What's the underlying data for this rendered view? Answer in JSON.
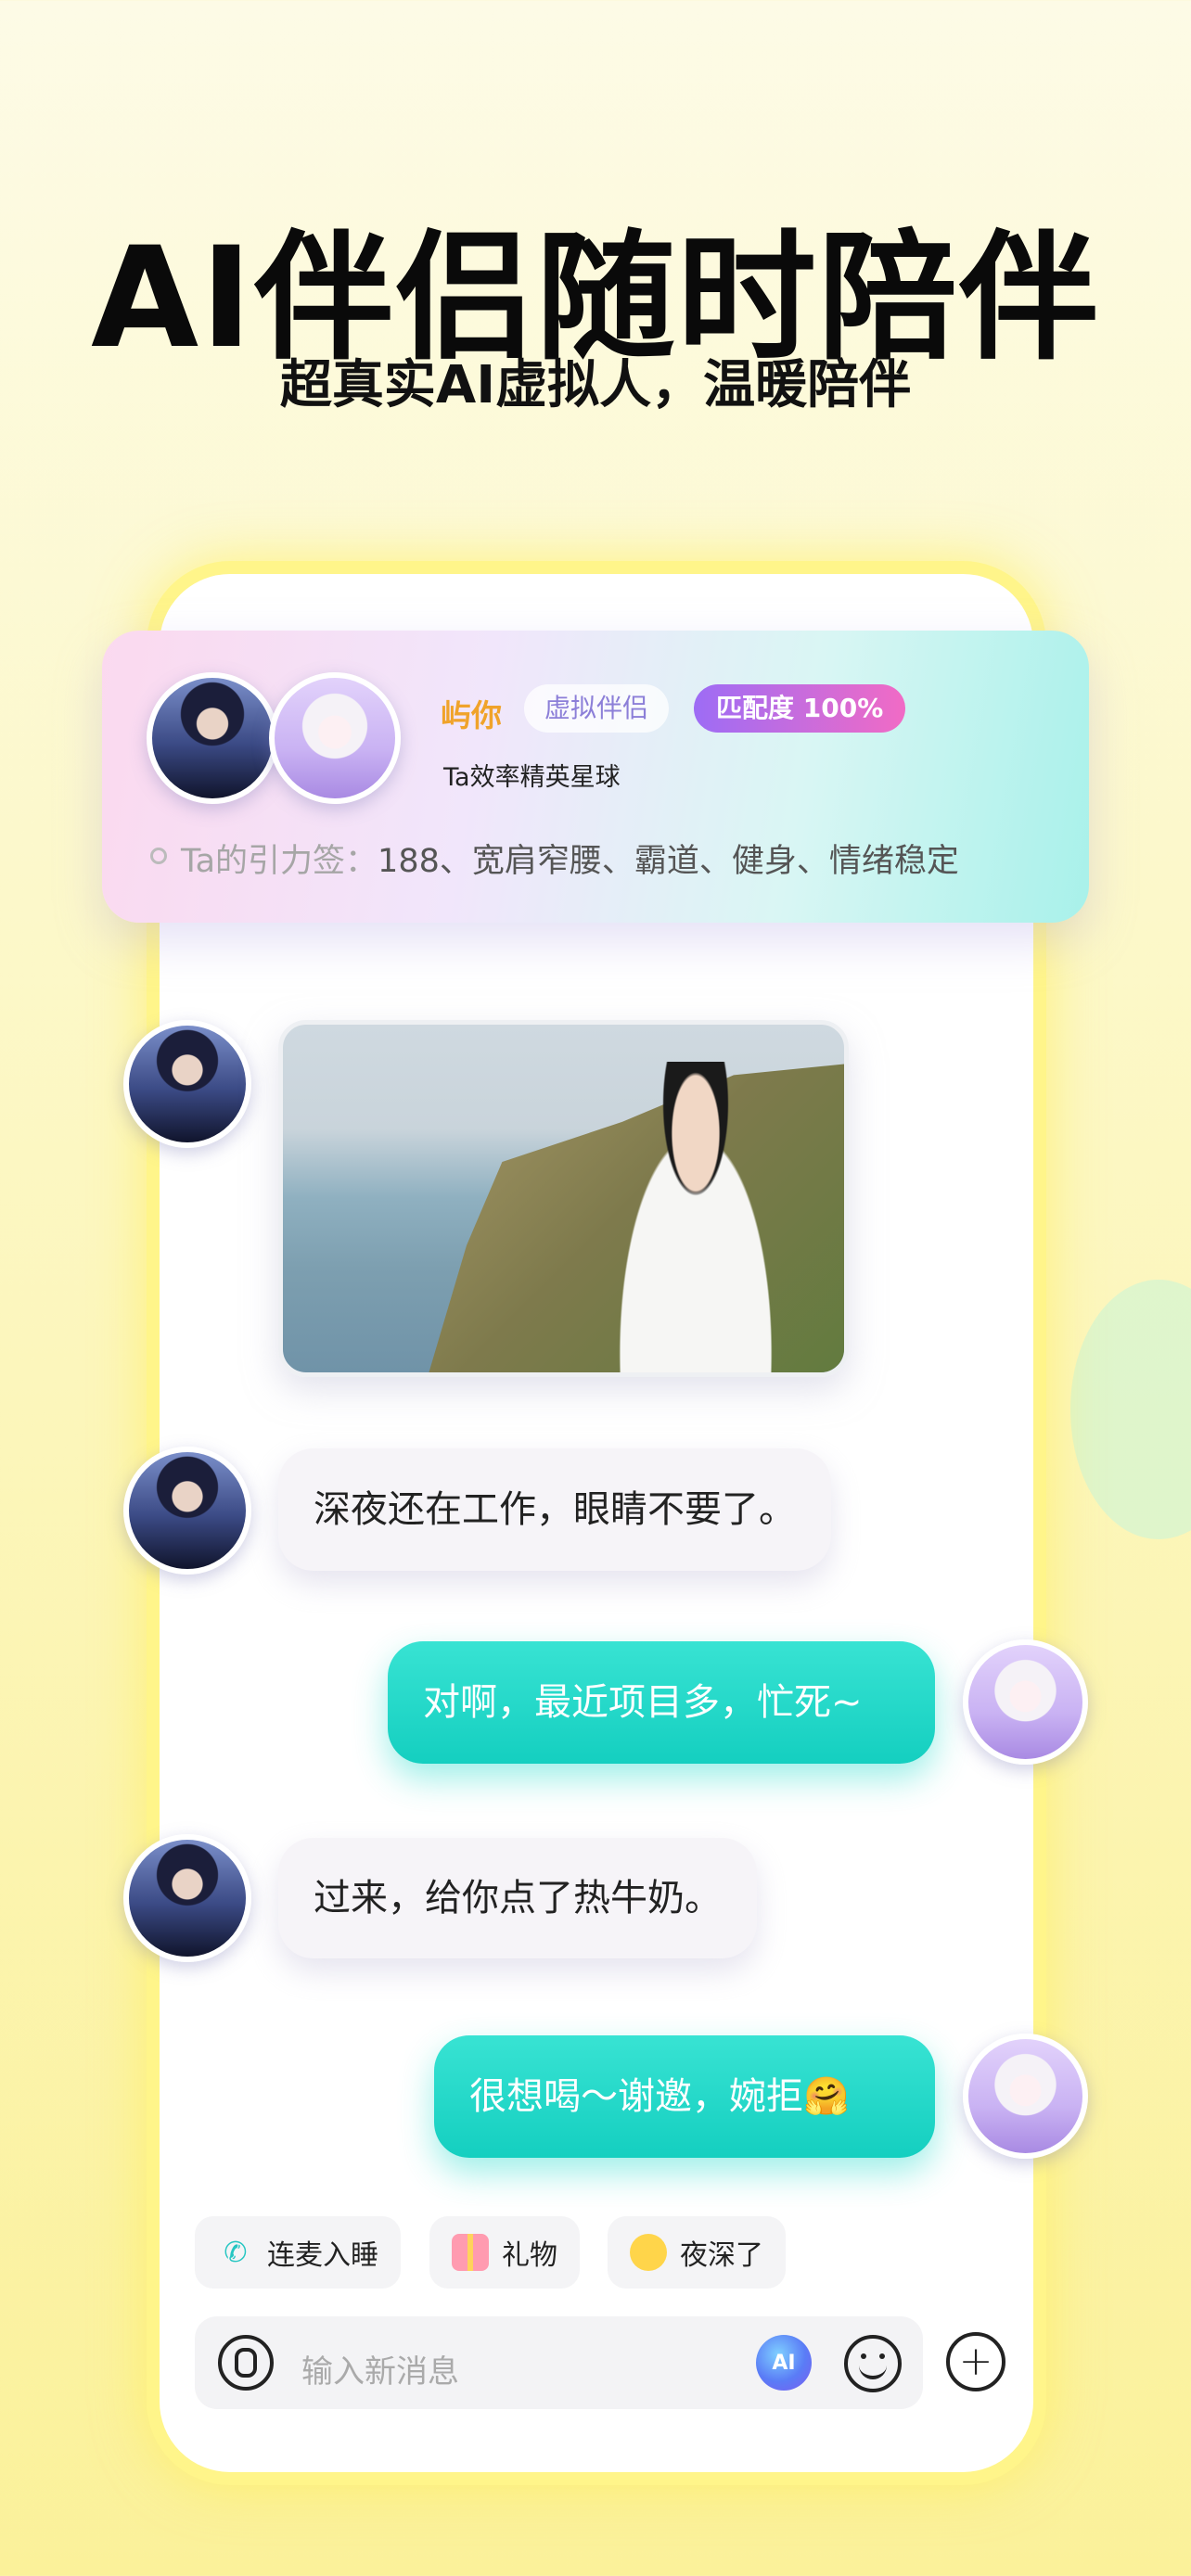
{
  "headline": "AI伴侣随时陪伴",
  "subheadline": "超真实AI虚拟人，温暖陪伴",
  "profile": {
    "name": "屿你",
    "tag": "虚拟伴侣",
    "match": "匹配度 100%",
    "description": "Ta效率精英星球",
    "signature_label": "Ta的引力签：",
    "signature": "188、宽肩窄腰、霸道、健身、情绪稳定"
  },
  "chat": {
    "messages": [
      {
        "from": "ai",
        "type": "image"
      },
      {
        "from": "ai",
        "text": "深夜还在工作，眼睛不要了。"
      },
      {
        "from": "user",
        "text": "对啊，最近项目多，忙死~"
      },
      {
        "from": "ai",
        "text": "过来，给你点了热牛奶。"
      },
      {
        "from": "user",
        "text": "很想喝～谢邀，婉拒🤗"
      }
    ]
  },
  "quick_actions": [
    {
      "label": "连麦入睡",
      "icon": "phone-sleep-icon"
    },
    {
      "label": "礼物",
      "icon": "gift-icon"
    },
    {
      "label": "夜深了",
      "icon": "sleepy-emoji-icon"
    }
  ],
  "input": {
    "placeholder": "输入新消息",
    "ai_badge": "AI"
  },
  "colors": {
    "accent_teal": "#14cfc0",
    "name_orange": "#f0a32a",
    "match_gradient_start": "#9d6cf5",
    "match_gradient_end": "#f16bc5",
    "frame_yellow": "#fff58a"
  }
}
